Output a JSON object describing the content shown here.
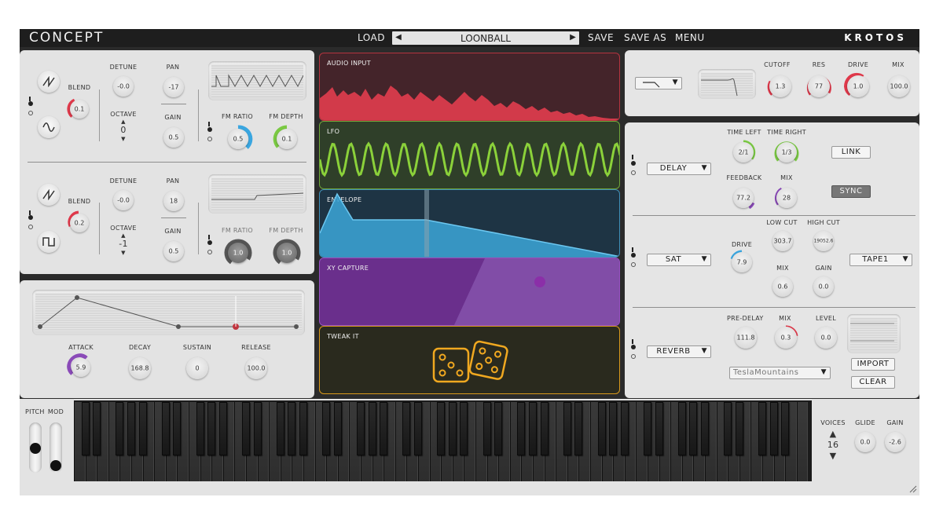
{
  "topbar": {
    "logo": "CONCEPT",
    "load": "LOAD",
    "preset_name": "LOONBALL",
    "prev_arrow": "◀",
    "next_arrow": "▶",
    "save": "SAVE",
    "save_as": "SAVE AS",
    "menu": "MENU",
    "brand": "KROTOS"
  },
  "osc1": {
    "blend_label": "BLEND",
    "blend_value": "0.1",
    "detune_label": "DETUNE",
    "detune_value": "-0.0",
    "octave_label": "OCTAVE",
    "octave_value": "0",
    "pan_label": "PAN",
    "pan_value": "-17",
    "gain_label": "GAIN",
    "gain_value": "0.5",
    "fm_ratio_label": "FM RATIO",
    "fm_ratio_value": "0.5",
    "fm_depth_label": "FM DEPTH",
    "fm_depth_value": "0.1"
  },
  "osc2": {
    "blend_label": "BLEND",
    "blend_value": "0.2",
    "detune_label": "DETUNE",
    "detune_value": "-0.0",
    "octave_label": "OCTAVE",
    "octave_value": "-1",
    "pan_label": "PAN",
    "pan_value": "18",
    "gain_label": "GAIN",
    "gain_value": "0.5",
    "fm_ratio_label": "FM RATIO",
    "fm_ratio_value": "1.0",
    "fm_depth_label": "FM DEPTH",
    "fm_depth_value": "1.0"
  },
  "envelope": {
    "attack_label": "ATTACK",
    "attack_value": "5.9",
    "decay_label": "DECAY",
    "decay_value": "168.8",
    "sustain_label": "SUSTAIN",
    "sustain_value": "0",
    "release_label": "RELEASE",
    "release_value": "100.0"
  },
  "modules": {
    "audio_input": "AUDIO INPUT",
    "lfo": "LFO",
    "envelope": "ENVELOPE",
    "xy_capture": "XY CAPTURE",
    "tweak_it": "TWEAK IT"
  },
  "filter": {
    "cutoff_label": "CUTOFF",
    "cutoff_value": "1.3",
    "res_label": "RES",
    "res_value": "77",
    "drive_label": "DRIVE",
    "drive_value": "1.0",
    "mix_label": "MIX",
    "mix_value": "100.0",
    "type_caret": "▼"
  },
  "delay": {
    "type": "DELAY",
    "time_left_label": "TIME LEFT",
    "time_left_value": "2/1",
    "time_right_label": "TIME RIGHT",
    "time_right_value": "1/3",
    "feedback_label": "FEEDBACK",
    "feedback_value": "77.2",
    "mix_label": "MIX",
    "mix_value": "28",
    "link": "LINK",
    "sync": "SYNC"
  },
  "saturation": {
    "type": "SAT",
    "drive_label": "DRIVE",
    "drive_value": "7.9",
    "low_cut_label": "LOW CUT",
    "low_cut_value": "303.7",
    "high_cut_label": "HIGH CUT",
    "high_cut_value": "19052.6",
    "mix_label": "MIX",
    "mix_value": "0.6",
    "gain_label": "GAIN",
    "gain_value": "0.0",
    "mode": "TAPE1"
  },
  "reverb": {
    "type": "REVERB",
    "pre_delay_label": "PRE-DELAY",
    "pre_delay_value": "111.8",
    "mix_label": "MIX",
    "mix_value": "0.3",
    "level_label": "LEVEL",
    "level_value": "0.0",
    "impulse": "TeslaMountains",
    "import": "IMPORT",
    "clear": "CLEAR"
  },
  "keyboard": {
    "pitch_label": "PITCH",
    "mod_label": "MOD",
    "voices_label": "VOICES",
    "voices_value": "16",
    "glide_label": "GLIDE",
    "glide_value": "0.0",
    "gain_label": "GAIN",
    "gain_value": "-2.6"
  },
  "colors": {
    "audio_input": "#d23a4a",
    "lfo": "#8bd13a",
    "envelope": "#3aa0d0",
    "xy": "#7b3fa0",
    "tweak": "#f0a820",
    "knob_red": "#e0394b",
    "knob_blue": "#3aa6e0",
    "knob_green": "#7ac943",
    "knob_purple": "#8a4ab8"
  }
}
